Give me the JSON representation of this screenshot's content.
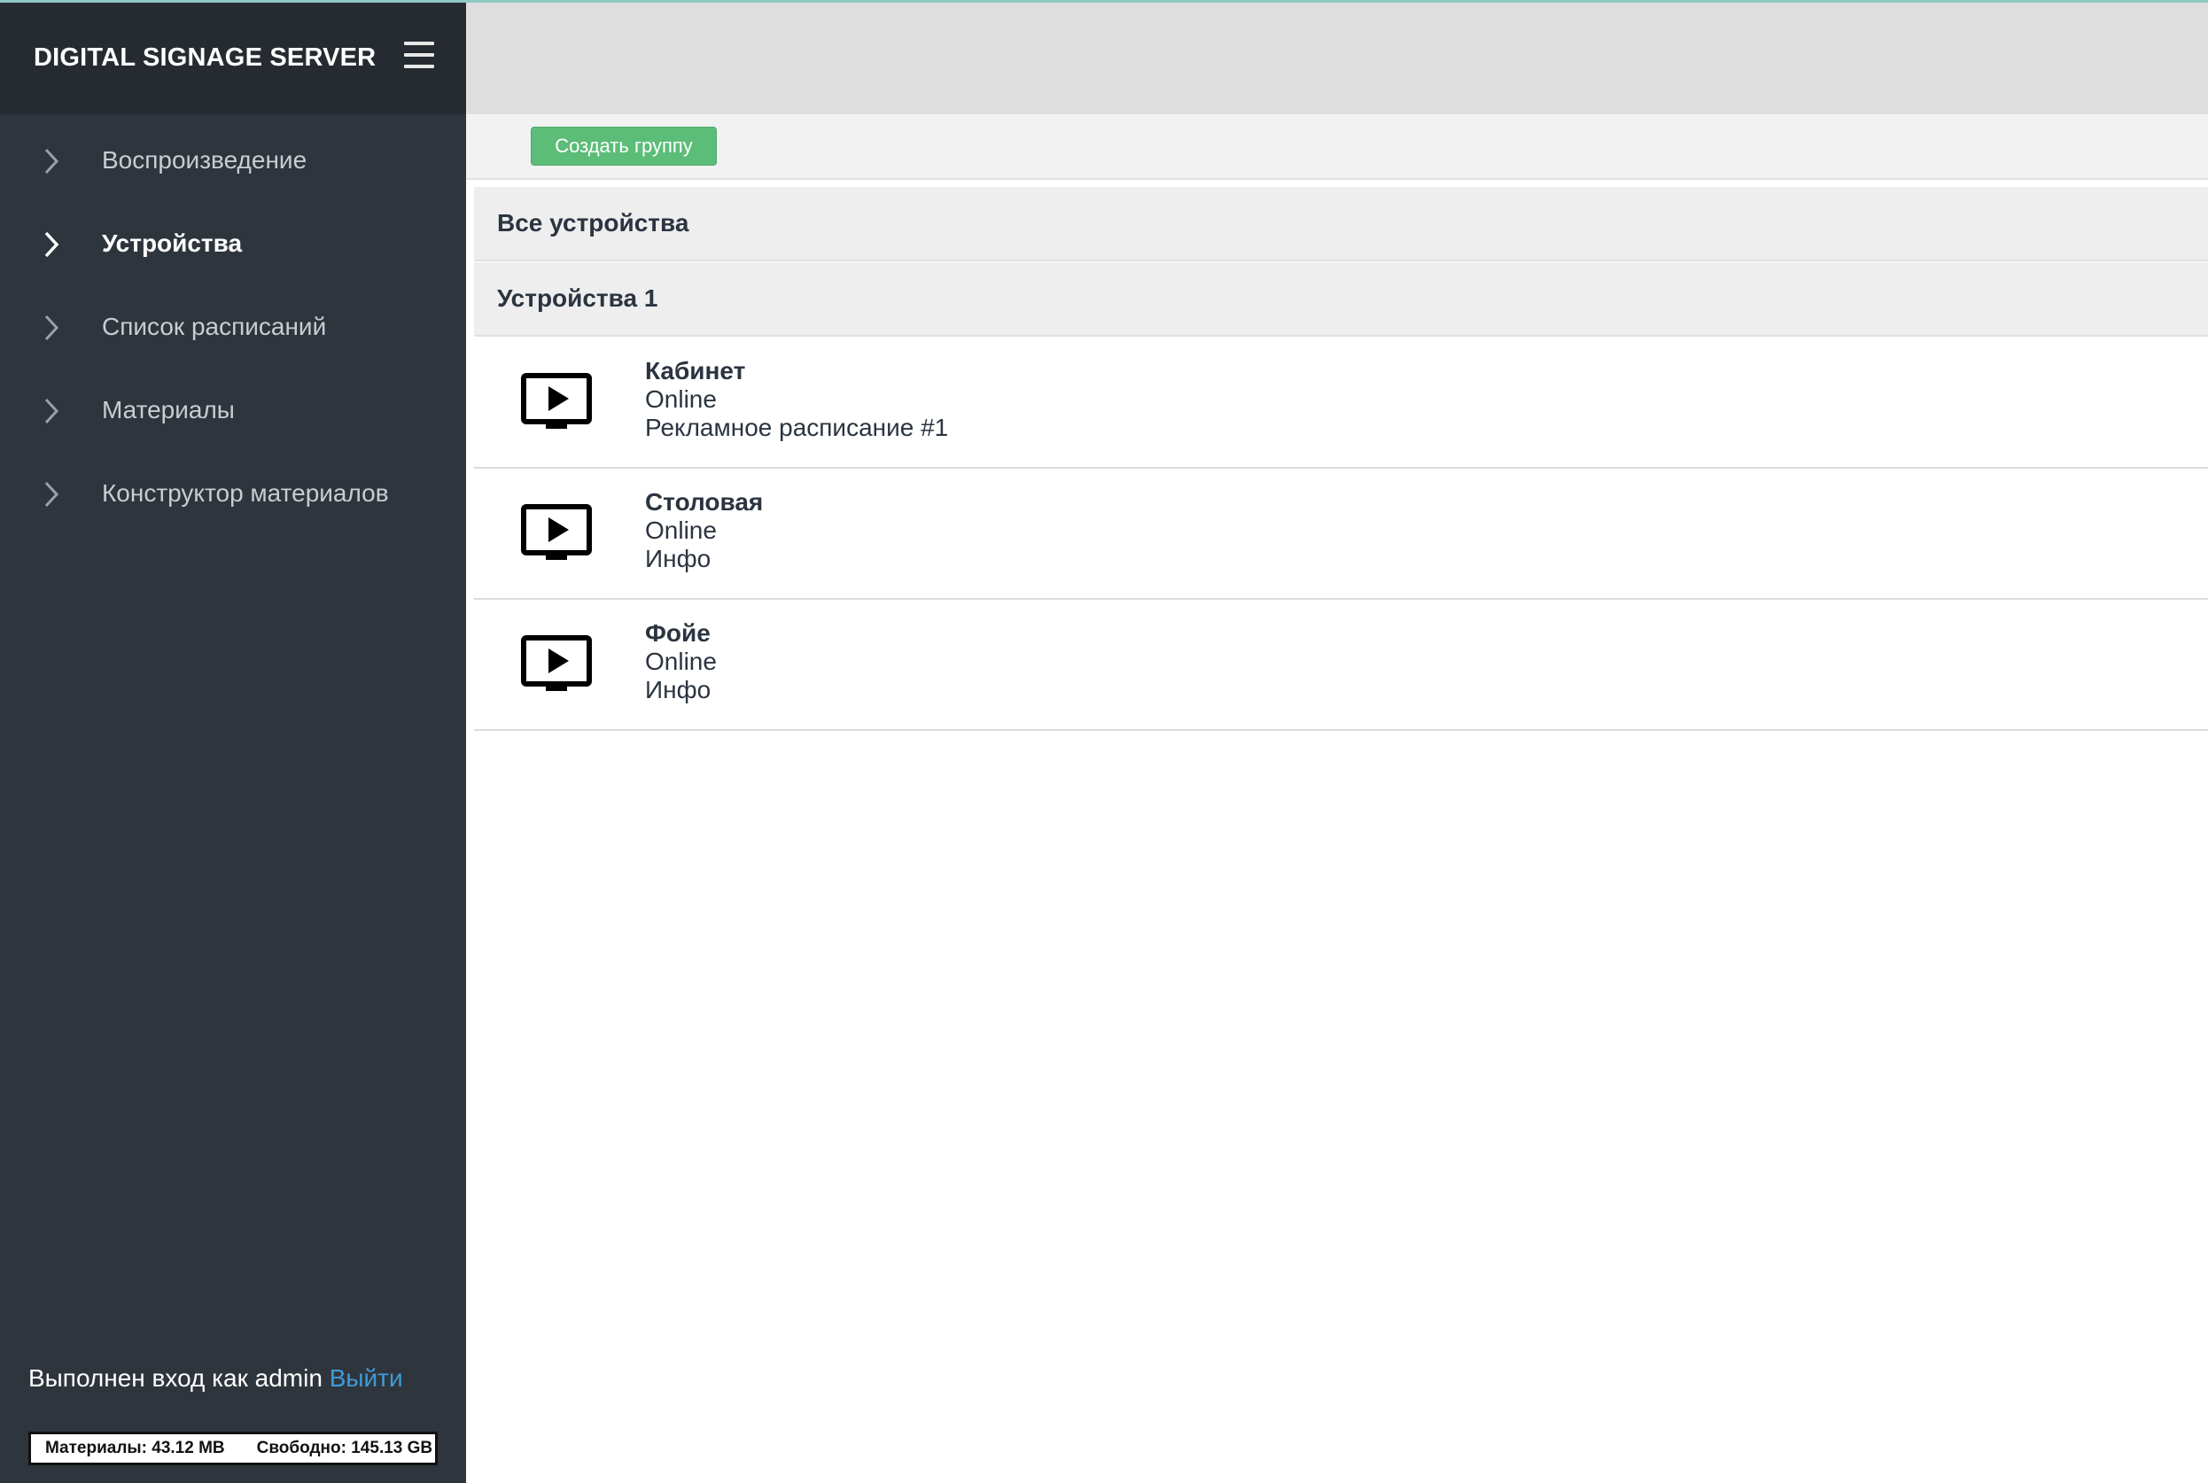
{
  "app": {
    "title": "DIGITAL SIGNAGE SERVER",
    "menu_icon": "hamburger-menu-icon"
  },
  "sidebar": {
    "items": [
      {
        "label": "Воспроизведение",
        "icon": "chevron-right-icon",
        "active": false
      },
      {
        "label": "Устройства",
        "icon": "chevron-right-icon",
        "active": true
      },
      {
        "label": "Список расписаний",
        "icon": "chevron-right-icon",
        "active": false
      },
      {
        "label": "Материалы",
        "icon": "chevron-right-icon",
        "active": false
      },
      {
        "label": "Конструктор материалов",
        "icon": "chevron-right-icon",
        "active": false
      }
    ],
    "login_text": "Выполнен вход как admin",
    "logout_label": "Выйти",
    "storage": {
      "materials": "Материалы: 43.12 MB",
      "free": "Свободно: 145.13 GB"
    }
  },
  "toolbar": {
    "create_group_label": "Создать группу"
  },
  "groups": [
    {
      "label": "Все устройства"
    },
    {
      "label": "Устройства 1"
    }
  ],
  "devices": [
    {
      "name": "Кабинет",
      "status": "Online",
      "schedule": "Рекламное расписание #1",
      "icon": "tv-play-icon"
    },
    {
      "name": "Столовая",
      "status": "Online",
      "schedule": "Инфо",
      "icon": "tv-play-icon"
    },
    {
      "name": "Фойе",
      "status": "Online",
      "schedule": "Инфо",
      "icon": "tv-play-icon"
    }
  ],
  "colors": {
    "sidebar_bg": "#2f353d",
    "sidebar_header_bg": "#262b32",
    "accent_green": "#5cbd78",
    "link_blue": "#3f9bd8",
    "text_dark": "#2b3440"
  }
}
